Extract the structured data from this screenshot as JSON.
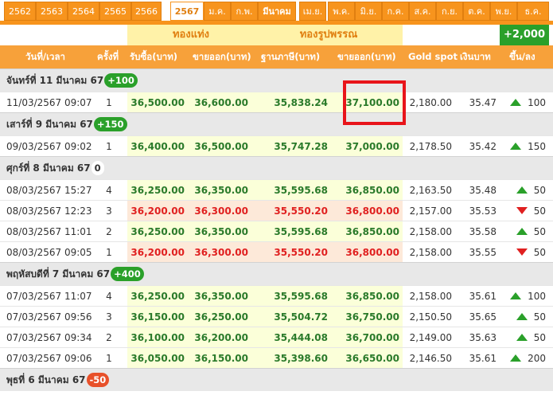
{
  "tabs": {
    "years": [
      "2562",
      "2563",
      "2564",
      "2565",
      "2566"
    ],
    "active_year": "2567",
    "months": [
      "ม.ค.",
      "ก.พ.",
      "มีนาคม",
      "เม.ย.",
      "พ.ค.",
      "มิ.ย.",
      "ก.ค.",
      "ส.ค.",
      "ก.ย.",
      "ต.ค.",
      "พ.ย.",
      "ธ.ค."
    ],
    "active_month": "มีนาคม"
  },
  "groups": {
    "gold_bar": "ทองแท่ง",
    "gold_ornament": "ทองรูปพรรณ",
    "total_change": "+2,000"
  },
  "columns": {
    "datetime": "วันที่/เวลา",
    "count": "ครั้งที่",
    "bar_buy": "รับซื้อ(บาท)",
    "bar_sell": "ขายออก(บาท)",
    "ornament_tax": "ฐานภาษี(บาท)",
    "ornament_sell": "ขายออก(บาท)",
    "gold_spot": "Gold spot",
    "thb": "เงินบาท",
    "change": "ขึ้น/ลง"
  },
  "days": [
    {
      "label": "จันทร์ที่ 11 มีนาคม 67",
      "badge": "+100",
      "badge_type": "up",
      "rows": [
        {
          "datetime": "11/03/2567 09:07",
          "count": "1",
          "bar_buy": "36,500.00",
          "bar_sell": "36,600.00",
          "ornament_tax": "35,838.24",
          "ornament_sell": "37,100.00",
          "gold_spot": "2,180.00",
          "thb": "35.47",
          "change": "100",
          "direction": "up"
        }
      ]
    },
    {
      "label": "เสาร์ที่ 9 มีนาคม 67",
      "badge": "+150",
      "badge_type": "up",
      "rows": [
        {
          "datetime": "09/03/2567 09:02",
          "count": "1",
          "bar_buy": "36,400.00",
          "bar_sell": "36,500.00",
          "ornament_tax": "35,747.28",
          "ornament_sell": "37,000.00",
          "gold_spot": "2,178.50",
          "thb": "35.42",
          "change": "150",
          "direction": "up"
        }
      ]
    },
    {
      "label": "ศุกร์ที่ 8 มีนาคม 67",
      "badge": "0",
      "badge_type": "zero",
      "rows": [
        {
          "datetime": "08/03/2567 15:27",
          "count": "4",
          "bar_buy": "36,250.00",
          "bar_sell": "36,350.00",
          "ornament_tax": "35,595.68",
          "ornament_sell": "36,850.00",
          "gold_spot": "2,163.50",
          "thb": "35.48",
          "change": "50",
          "direction": "up"
        },
        {
          "datetime": "08/03/2567 12:23",
          "count": "3",
          "bar_buy": "36,200.00",
          "bar_sell": "36,300.00",
          "ornament_tax": "35,550.20",
          "ornament_sell": "36,800.00",
          "gold_spot": "2,157.00",
          "thb": "35.53",
          "change": "50",
          "direction": "down"
        },
        {
          "datetime": "08/03/2567 11:01",
          "count": "2",
          "bar_buy": "36,250.00",
          "bar_sell": "36,350.00",
          "ornament_tax": "35,595.68",
          "ornament_sell": "36,850.00",
          "gold_spot": "2,158.00",
          "thb": "35.58",
          "change": "50",
          "direction": "up"
        },
        {
          "datetime": "08/03/2567 09:05",
          "count": "1",
          "bar_buy": "36,200.00",
          "bar_sell": "36,300.00",
          "ornament_tax": "35,550.20",
          "ornament_sell": "36,800.00",
          "gold_spot": "2,158.00",
          "thb": "35.55",
          "change": "50",
          "direction": "down"
        }
      ]
    },
    {
      "label": "พฤหัสบดีที่ 7 มีนาคม 67",
      "badge": "+400",
      "badge_type": "up",
      "rows": [
        {
          "datetime": "07/03/2567 11:07",
          "count": "4",
          "bar_buy": "36,250.00",
          "bar_sell": "36,350.00",
          "ornament_tax": "35,595.68",
          "ornament_sell": "36,850.00",
          "gold_spot": "2,158.00",
          "thb": "35.61",
          "change": "100",
          "direction": "up"
        },
        {
          "datetime": "07/03/2567 09:56",
          "count": "3",
          "bar_buy": "36,150.00",
          "bar_sell": "36,250.00",
          "ornament_tax": "35,504.72",
          "ornament_sell": "36,750.00",
          "gold_spot": "2,150.50",
          "thb": "35.65",
          "change": "50",
          "direction": "up"
        },
        {
          "datetime": "07/03/2567 09:34",
          "count": "2",
          "bar_buy": "36,100.00",
          "bar_sell": "36,200.00",
          "ornament_tax": "35,444.08",
          "ornament_sell": "36,700.00",
          "gold_spot": "2,149.00",
          "thb": "35.63",
          "change": "50",
          "direction": "up"
        },
        {
          "datetime": "07/03/2567 09:06",
          "count": "1",
          "bar_buy": "36,050.00",
          "bar_sell": "36,150.00",
          "ornament_tax": "35,398.60",
          "ornament_sell": "36,650.00",
          "gold_spot": "2,146.50",
          "thb": "35.61",
          "change": "200",
          "direction": "up"
        }
      ]
    },
    {
      "label": "พุธที่ 6 มีนาคม 67",
      "badge": "-50",
      "badge_type": "down",
      "rows": []
    }
  ],
  "colors": {
    "accent_orange": "#f7941d",
    "up_green": "#2aa02a",
    "down_red": "#e02020",
    "highlight_red": "#e8141a"
  }
}
